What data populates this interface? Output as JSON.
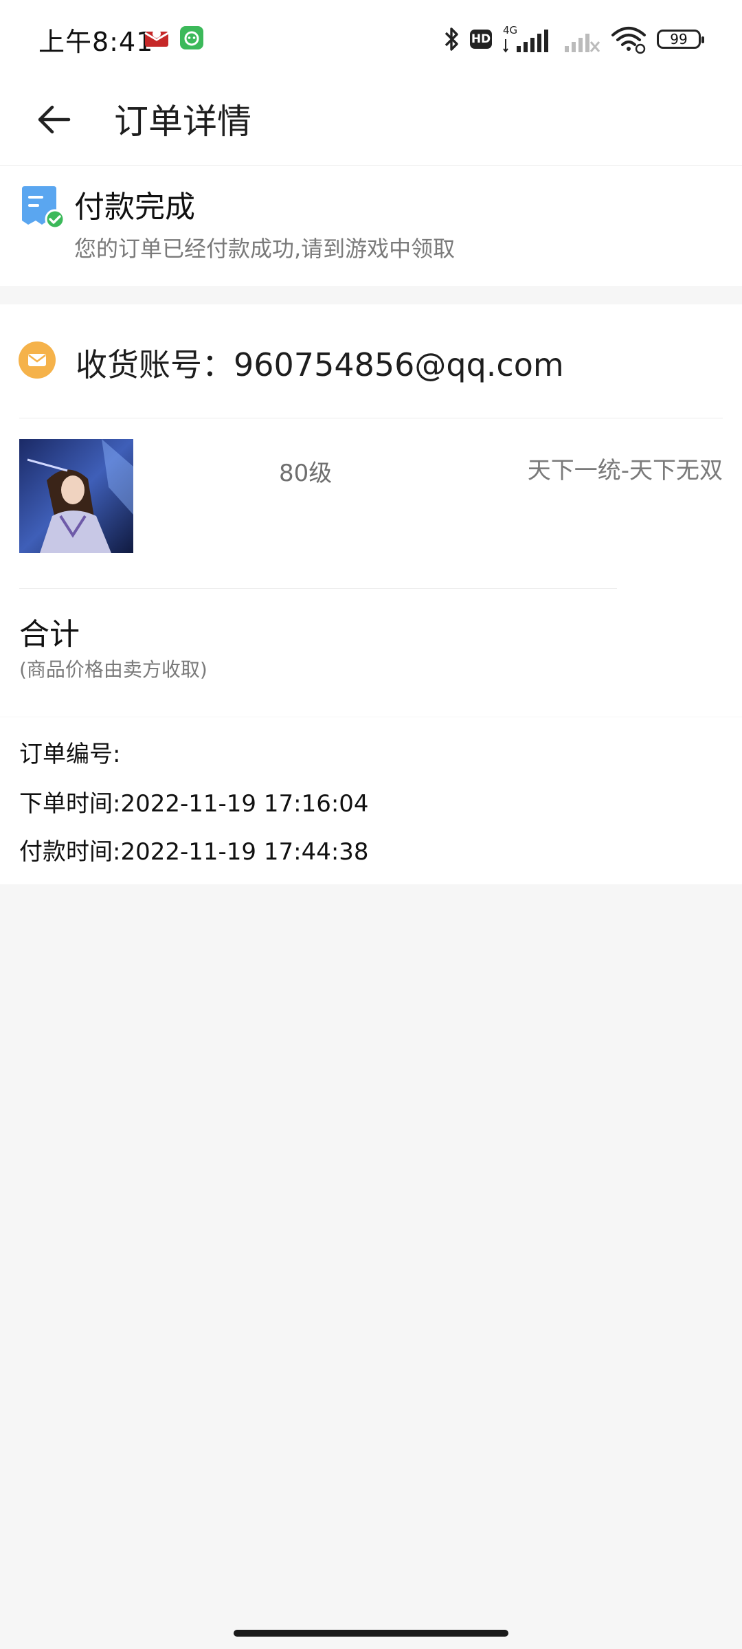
{
  "status_bar": {
    "time": "上午8:41",
    "hd_badge": "HD",
    "network": "4G",
    "battery": "99"
  },
  "header": {
    "title": "订单详情"
  },
  "order_status": {
    "title": "付款完成",
    "description": "您的订单已经付款成功,请到游戏中领取"
  },
  "account": {
    "text": "收货账号：960754856@qq.com"
  },
  "product": {
    "level": "80级",
    "server": "天下一统-天下无双"
  },
  "total": {
    "label": "合计",
    "note": "(商品价格由卖方收取)"
  },
  "order_info": {
    "order_number": "订单编号:",
    "order_time": "下单时间:2022-11-19 17:16:04",
    "pay_time": "付款时间:2022-11-19 17:44:38"
  },
  "colors": {
    "accent_green": "#3cb95a",
    "status_blue": "#5aa6f0",
    "mail_orange": "#f5b24a",
    "page_bg": "#f6f6f6"
  }
}
